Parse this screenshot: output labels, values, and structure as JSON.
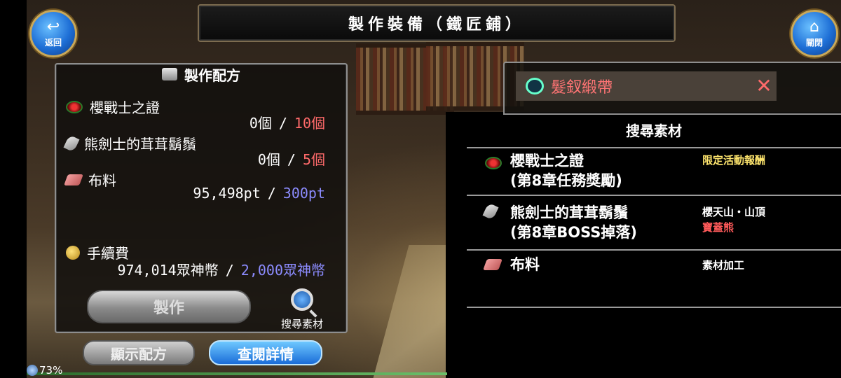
{
  "header": {
    "title": "製作裝備（鐵匠鋪）"
  },
  "nav": {
    "back_label": "返回",
    "close_label": "關閉"
  },
  "recipe": {
    "title": "製作配方",
    "materials": [
      {
        "name": "櫻戰士之證",
        "have": "0個",
        "need": "10個",
        "icon": "red-ring-icon"
      },
      {
        "name": "熊劍士的茸茸鬍鬚",
        "have": "0個",
        "need": "5個",
        "icon": "feather-icon"
      },
      {
        "name": "布料",
        "have": "95,498pt",
        "need": "300pt",
        "icon": "cloth-icon"
      }
    ],
    "fee": {
      "label": "手續費",
      "have": "974,014眾神幣",
      "need": "2,000眾神幣"
    },
    "make_label": "製作",
    "search_label": "搜尋素材"
  },
  "buttons": {
    "show_recipe": "顯示配方",
    "view_details": "查閱詳情"
  },
  "status": {
    "battery": "73%"
  },
  "item": {
    "name": "髮釵緞帶"
  },
  "search_panel": {
    "title": "搜尋素材",
    "rows": [
      {
        "name_line1": "櫻戰士之證",
        "name_line2": "(第8章任務獎勵)",
        "loc1": "限定活動報酬",
        "loc2": ""
      },
      {
        "name_line1": "熊劍士的茸茸鬍鬚",
        "name_line2": "(第8章BOSS掉落)",
        "loc1": "櫻天山・山頂",
        "loc2": "寶蓋熊"
      },
      {
        "name_line1": "布料",
        "name_line2": "",
        "loc1": "素材加工",
        "loc2": ""
      }
    ]
  }
}
